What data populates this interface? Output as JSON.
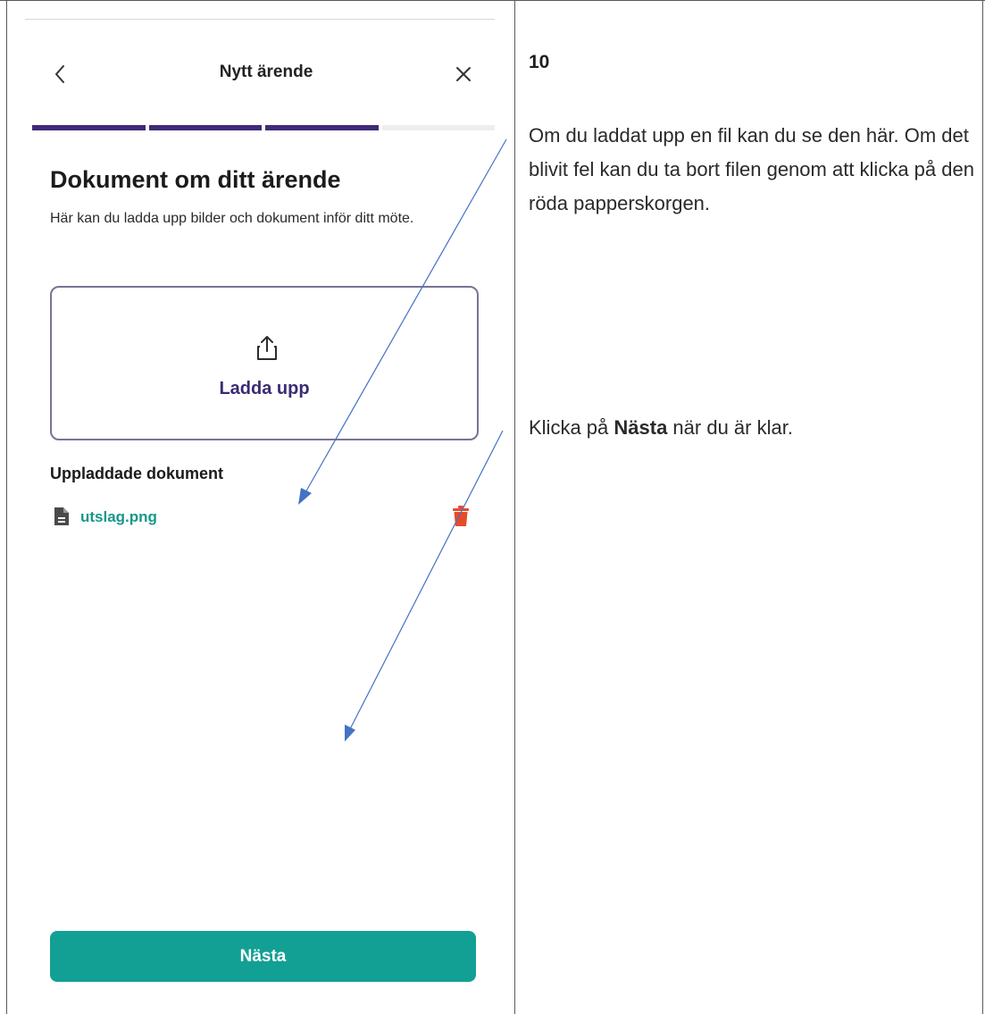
{
  "app": {
    "title": "Nytt ärende",
    "progress": {
      "completed_steps": 3,
      "total_steps": 4
    }
  },
  "page": {
    "heading": "Dokument om ditt ärende",
    "description": "Här kan du ladda upp bilder och dokument inför ditt möte.",
    "upload_label": "Ladda upp",
    "uploaded_heading": "Uppladdade dokument",
    "files": [
      {
        "name": "utslag.png"
      }
    ],
    "next_label": "Nästa"
  },
  "instructions": {
    "step_number": "10",
    "text_1": "Om du laddat upp en fil kan du se den här. Om det blivit fel kan du ta bort filen genom att klicka på den röda papperskorgen.",
    "text_2_before": "Klicka på ",
    "text_2_bold": "Nästa",
    "text_2_after": " när du är klar."
  },
  "icons": {
    "back": "chevron-left-icon",
    "close": "close-icon",
    "upload": "upload-icon",
    "file": "file-icon",
    "delete": "trash-icon"
  },
  "colors": {
    "progress_done": "#3f2b78",
    "progress_todo": "#eeeeee",
    "accent_purple": "#3b2a73",
    "link_teal": "#17978c",
    "button_teal": "#12a095",
    "delete_red": "#e8492a",
    "arrow_blue": "#4472c4"
  }
}
